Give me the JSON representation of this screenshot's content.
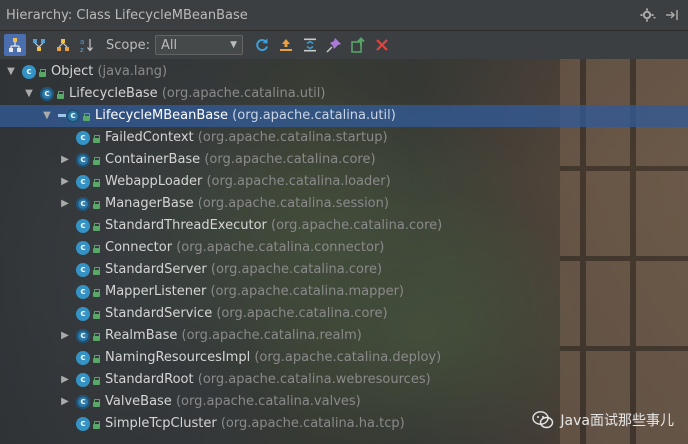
{
  "window": {
    "title": "Hierarchy: Class LifecycleMBeanBase"
  },
  "titlebar_icons": [
    "gear-icon",
    "pin-to-edge-icon"
  ],
  "toolbar": {
    "buttons": [
      {
        "name": "class-hierarchy-icon",
        "active": true
      },
      {
        "name": "supertypes-hierarchy-icon",
        "active": false
      },
      {
        "name": "subtypes-hierarchy-icon",
        "active": false
      },
      {
        "name": "sort-alphabetically-icon",
        "active": false
      }
    ],
    "scope_label": "Scope:",
    "scope_value": "All",
    "actions": [
      "refresh-icon",
      "autoscroll-icon",
      "expand-all-icon",
      "pin-icon",
      "export-icon",
      "close-icon"
    ]
  },
  "tree": [
    {
      "depth": 0,
      "arrow": "▼",
      "name": "Object",
      "pkg": "(java.lang)",
      "abstract": false,
      "selected": false
    },
    {
      "depth": 1,
      "arrow": "▼",
      "name": "LifecycleBase",
      "pkg": "(org.apache.catalina.util)",
      "abstract": true,
      "selected": false
    },
    {
      "depth": 2,
      "arrow": "▼",
      "name": "LifecycleMBeanBase",
      "pkg": "(org.apache.catalina.util)",
      "abstract": true,
      "selected": true
    },
    {
      "depth": 3,
      "arrow": "",
      "name": "FailedContext",
      "pkg": "(org.apache.catalina.startup)",
      "abstract": false,
      "selected": false
    },
    {
      "depth": 3,
      "arrow": "▶",
      "name": "ContainerBase",
      "pkg": "(org.apache.catalina.core)",
      "abstract": true,
      "selected": false
    },
    {
      "depth": 3,
      "arrow": "▶",
      "name": "WebappLoader",
      "pkg": "(org.apache.catalina.loader)",
      "abstract": false,
      "selected": false
    },
    {
      "depth": 3,
      "arrow": "▶",
      "name": "ManagerBase",
      "pkg": "(org.apache.catalina.session)",
      "abstract": true,
      "selected": false
    },
    {
      "depth": 3,
      "arrow": "",
      "name": "StandardThreadExecutor",
      "pkg": "(org.apache.catalina.core)",
      "abstract": false,
      "selected": false
    },
    {
      "depth": 3,
      "arrow": "",
      "name": "Connector",
      "pkg": "(org.apache.catalina.connector)",
      "abstract": false,
      "selected": false
    },
    {
      "depth": 3,
      "arrow": "",
      "name": "StandardServer",
      "pkg": "(org.apache.catalina.core)",
      "abstract": false,
      "selected": false
    },
    {
      "depth": 3,
      "arrow": "",
      "name": "MapperListener",
      "pkg": "(org.apache.catalina.mapper)",
      "abstract": false,
      "selected": false
    },
    {
      "depth": 3,
      "arrow": "",
      "name": "StandardService",
      "pkg": "(org.apache.catalina.core)",
      "abstract": false,
      "selected": false
    },
    {
      "depth": 3,
      "arrow": "▶",
      "name": "RealmBase",
      "pkg": "(org.apache.catalina.realm)",
      "abstract": true,
      "selected": false
    },
    {
      "depth": 3,
      "arrow": "",
      "name": "NamingResourcesImpl",
      "pkg": "(org.apache.catalina.deploy)",
      "abstract": false,
      "selected": false
    },
    {
      "depth": 3,
      "arrow": "▶",
      "name": "StandardRoot",
      "pkg": "(org.apache.catalina.webresources)",
      "abstract": false,
      "selected": false
    },
    {
      "depth": 3,
      "arrow": "▶",
      "name": "ValveBase",
      "pkg": "(org.apache.catalina.valves)",
      "abstract": true,
      "selected": false
    },
    {
      "depth": 3,
      "arrow": "",
      "name": "SimpleTcpCluster",
      "pkg": "(org.apache.catalina.ha.tcp)",
      "abstract": false,
      "selected": false
    }
  ],
  "watermark": {
    "text": "Java面试那些事儿"
  },
  "colors": {
    "selection": "#3a5b8a",
    "class_icon": "#3592c4",
    "panel": "#3c3f41"
  }
}
